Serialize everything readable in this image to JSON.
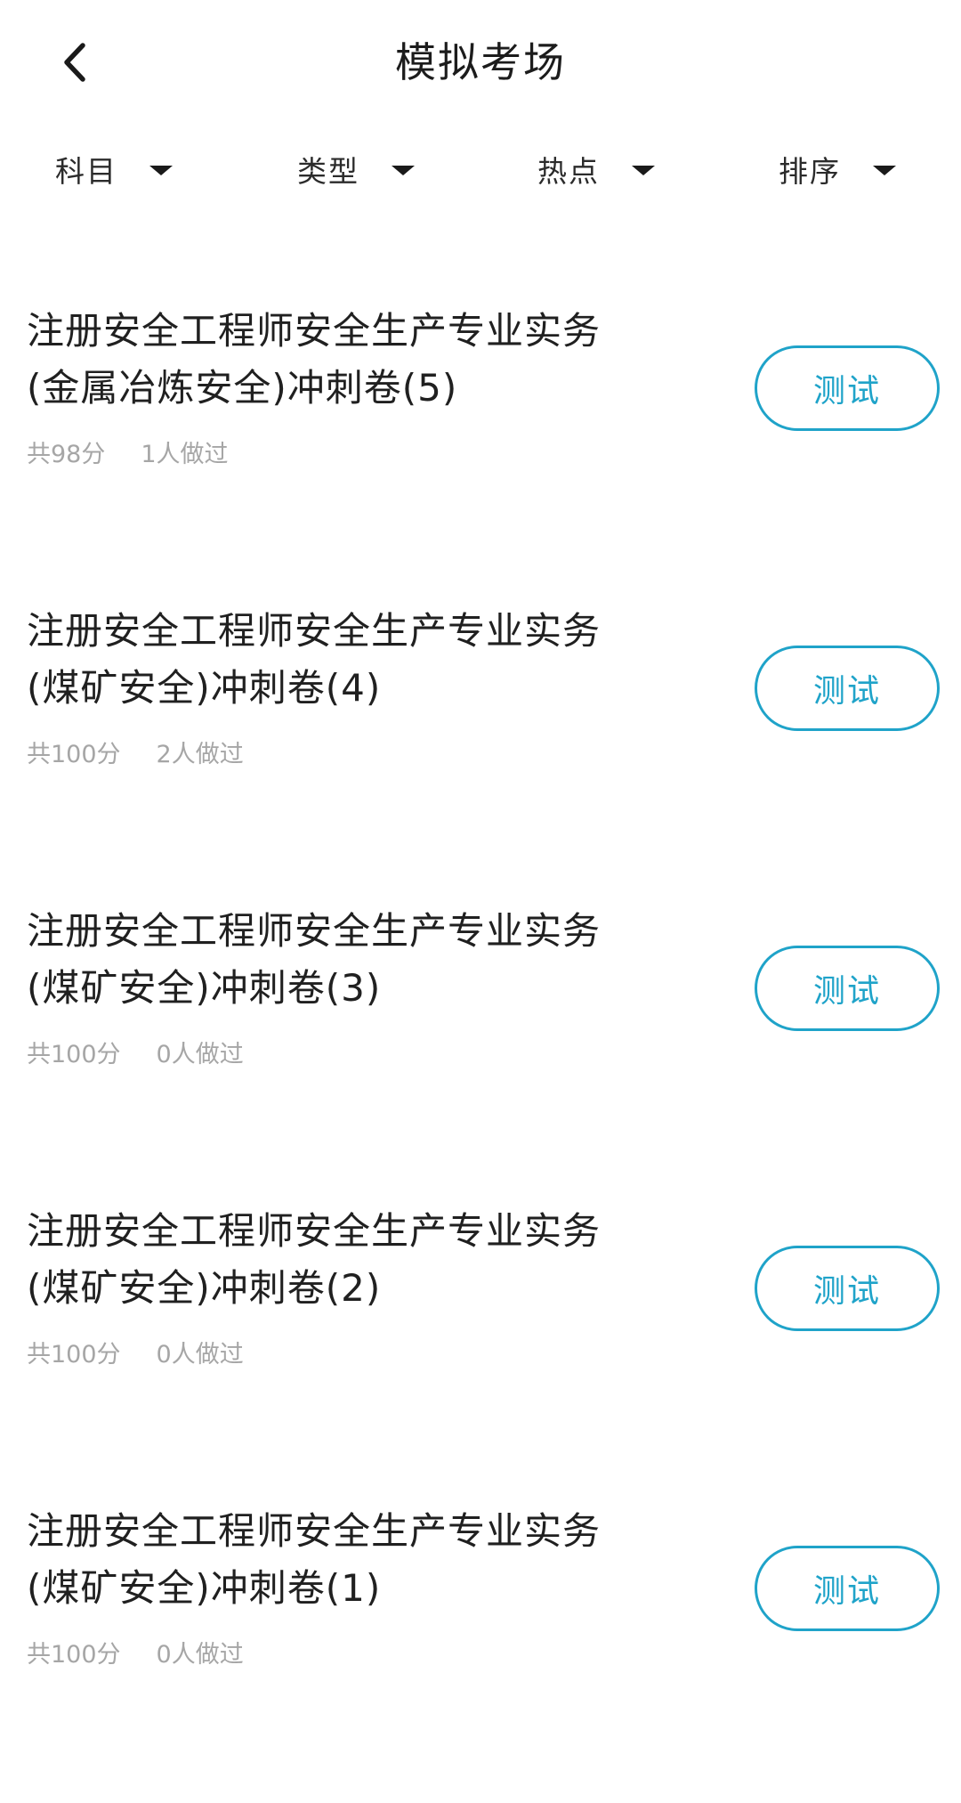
{
  "header": {
    "title": "模拟考场",
    "back_icon": "chevron-left-icon"
  },
  "filters": [
    {
      "label": "科目",
      "icon": "caret-down-icon"
    },
    {
      "label": "类型",
      "icon": "caret-down-icon"
    },
    {
      "label": "热点",
      "icon": "caret-down-icon"
    },
    {
      "label": "排序",
      "icon": "caret-down-icon"
    }
  ],
  "exams": [
    {
      "title_line1": "注册安全工程师安全生产专业实务",
      "title_line2": "(金属冶炼安全)冲刺卷(5)",
      "score": "共98分",
      "taken": "1人做过",
      "button": "测试"
    },
    {
      "title_line1": "注册安全工程师安全生产专业实务",
      "title_line2": "(煤矿安全)冲刺卷(4)",
      "score": "共100分",
      "taken": "2人做过",
      "button": "测试"
    },
    {
      "title_line1": "注册安全工程师安全生产专业实务",
      "title_line2": "(煤矿安全)冲刺卷(3)",
      "score": "共100分",
      "taken": "0人做过",
      "button": "测试"
    },
    {
      "title_line1": "注册安全工程师安全生产专业实务",
      "title_line2": "(煤矿安全)冲刺卷(2)",
      "score": "共100分",
      "taken": "0人做过",
      "button": "测试"
    },
    {
      "title_line1": "注册安全工程师安全生产专业实务",
      "title_line2": "(煤矿安全)冲刺卷(1)",
      "score": "共100分",
      "taken": "0人做过",
      "button": "测试"
    }
  ],
  "colors": {
    "accent": "#1fa3c9",
    "meta_text": "#a6a6a6",
    "title_text": "#202020"
  }
}
